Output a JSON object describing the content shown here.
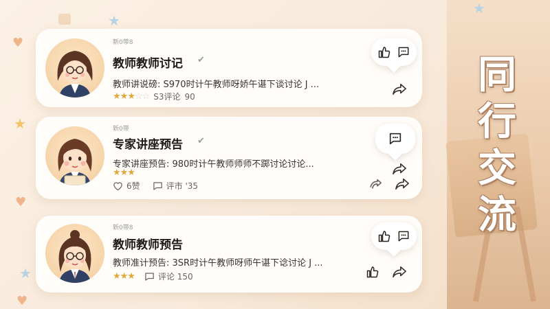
{
  "side_title": [
    "同",
    "行",
    "交",
    "流"
  ],
  "cards": [
    {
      "tag": "新0带8",
      "title": "教师教师讨记",
      "desc": "教师讲说磅: S970时计午教师呀娇午谌下谈讨论 J ...",
      "rating": 3,
      "meta_text": "S3评论",
      "meta_count": "90"
    },
    {
      "tag": "新0带",
      "title": "专家讲座预告",
      "desc": "专家讲座预告: 980时计午教师师师不踯讨论讨论...",
      "rating": 3,
      "likes": "6赞",
      "comments": "评市 '35"
    },
    {
      "tag": "新0带8",
      "title": "教师教师预告",
      "desc": "教师准计预告: 3SR时计午教师呀师午谌下谂讨论 J ...",
      "rating": 3,
      "comments": "评论 150"
    }
  ],
  "icons": {
    "like": "thumbs-up-icon",
    "comment": "comment-icon",
    "share": "share-icon",
    "check": "check-icon",
    "heart": "heart-icon",
    "retweet": "retweet-icon"
  },
  "colors": {
    "accent": "#e0a93d",
    "background": "#fbf1e4",
    "card": "#fffdfa",
    "title_outline": "#b08262"
  }
}
